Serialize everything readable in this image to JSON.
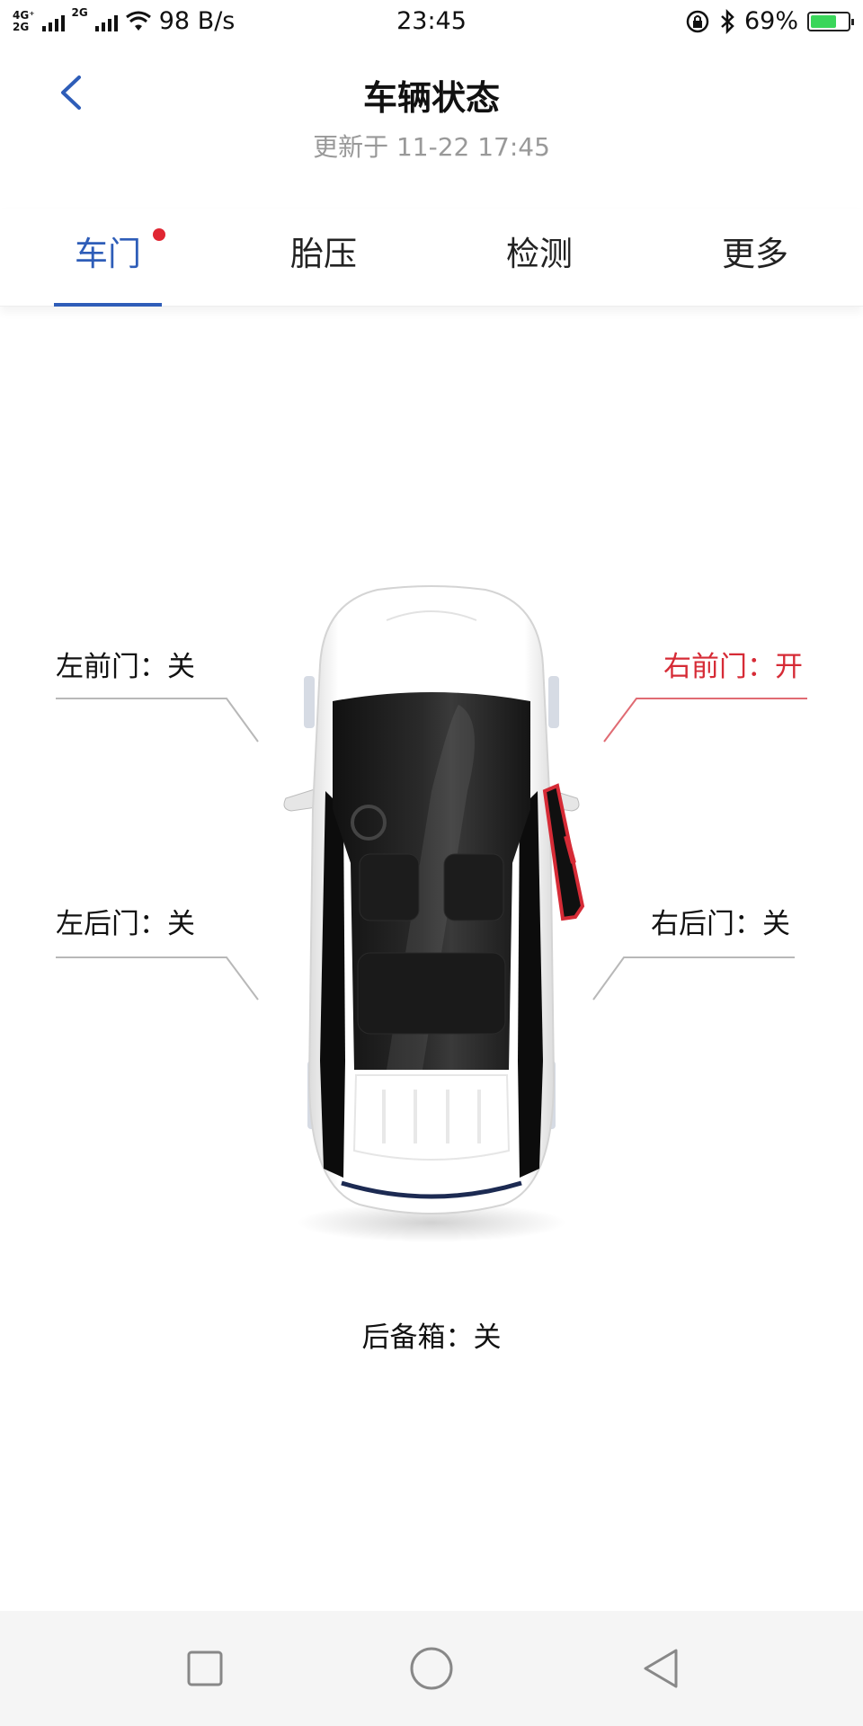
{
  "status_bar": {
    "net_top": "4G⁺",
    "net_bottom": "2G",
    "net2": "2G",
    "speed": "98 B/s",
    "time": "23:45",
    "battery": "69%",
    "battery_level": 0.69,
    "icons": [
      "signal-icon",
      "wifi-icon",
      "lock-rotation-icon",
      "bluetooth-icon",
      "battery-icon"
    ]
  },
  "header": {
    "title": "车辆状态",
    "subtitle": "更新于 11-22 17:45"
  },
  "tabs": [
    {
      "label": "车门",
      "active": true,
      "badge": true
    },
    {
      "label": "胎压"
    },
    {
      "label": "检测"
    },
    {
      "label": "更多"
    }
  ],
  "doors": {
    "front_left": "左前门：关",
    "front_right": "右前门：开",
    "rear_left": "左后门：关",
    "rear_right": "右后门：关",
    "trunk": "后备箱：关"
  },
  "colors": {
    "accent": "#2e5db8",
    "open": "#d62b36",
    "badge": "#e02632"
  },
  "nav": [
    "recents-square-icon",
    "home-circle-icon",
    "back-triangle-icon"
  ]
}
